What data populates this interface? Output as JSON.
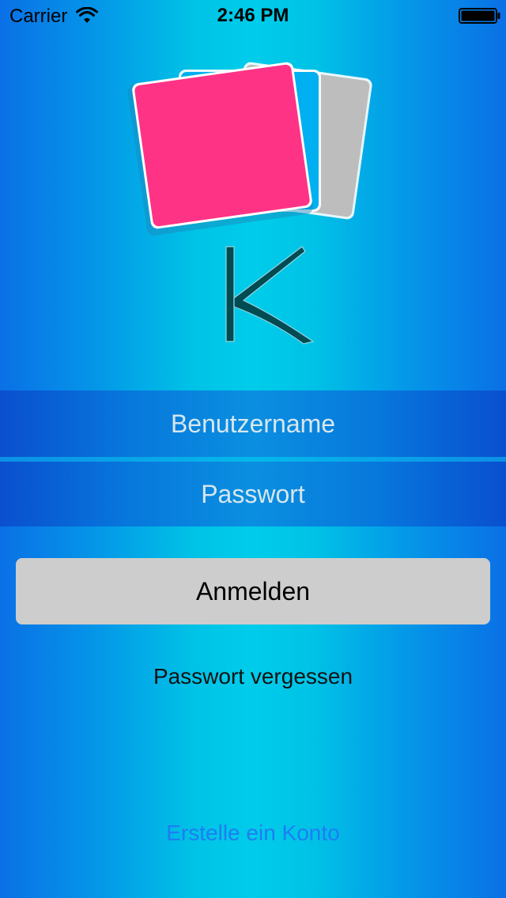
{
  "status_bar": {
    "carrier": "Carrier",
    "time": "2:46 PM"
  },
  "icons": {
    "wifi": "wifi-icon",
    "battery": "battery-icon",
    "logo": "stacked-cards-k-logo"
  },
  "login": {
    "username_placeholder": "Benutzername",
    "username_value": "",
    "password_placeholder": "Passwort",
    "password_value": "",
    "submit_label": "Anmelden",
    "forgot_password_label": "Passwort vergessen",
    "create_account_label": "Erstelle ein Konto"
  },
  "colors": {
    "card_pink": "#ff3386",
    "card_blue": "#00b0f0",
    "card_gray": "#bdbdbd",
    "letter": "#014b52",
    "button": "#cdcdcd",
    "link": "#1f7df2"
  }
}
